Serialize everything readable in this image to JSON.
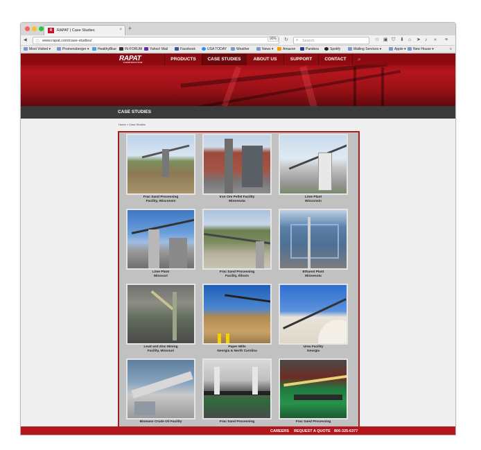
{
  "browser": {
    "tab_title": "RAPAT | Case Studies",
    "favicon_text": "R",
    "tab_close": "×",
    "new_tab": "+",
    "url": "www.rapat.com/case-studies/",
    "zoom": "90%",
    "search_placeholder": "Search",
    "back": "◀",
    "forward": "▶",
    "info": "ⓘ",
    "reload": "↻",
    "search_glyph": "⌕",
    "toolbar_icons": [
      "☆",
      "▣",
      "⛉",
      "⬇",
      "⌂",
      "➤",
      "♪",
      "»",
      "≡"
    ],
    "bookmarks": [
      "Most Visited ▾",
      "Promensberger ▾",
      "HealthyBlue",
      "IN-FORUM",
      "Yahoo! Mail",
      "Facebook",
      "USA TODAY",
      "Weather",
      "News ▾",
      "Amazon",
      "Pandora",
      "Spotify",
      "Mailing Services ▾",
      "Apple ▾",
      "New House ▾"
    ],
    "bookmarks_overflow": "»"
  },
  "site": {
    "logo": "RAPAT",
    "logo_sub": "CORPORATION",
    "nav": [
      "PRODUCTS",
      "CASE STUDIES",
      "ABOUT US",
      "SUPPORT",
      "CONTACT"
    ],
    "nav_search": "⌕",
    "page_title": "CASE STUDIES",
    "breadcrumb": "Home > Case Studies"
  },
  "cards": [
    {
      "line1": "Frac Sand Processing",
      "line2": "Facility, Wisconsin"
    },
    {
      "line1": "Iron Ore Pellet Facility",
      "line2": "Minnesota"
    },
    {
      "line1": "Lime Plant",
      "line2": "Wisconsin"
    },
    {
      "line1": "Lime Plant",
      "line2": "Missouri"
    },
    {
      "line1": "Frac Sand Processing",
      "line2": "Facility, Illinois"
    },
    {
      "line1": "Ethanol Plant",
      "line2": "Minnesota"
    },
    {
      "line1": "Lead and Zinc Mining",
      "line2": "Facility, Missouri"
    },
    {
      "line1": "Paper Mills",
      "line2": "Georgia & North Carolina"
    },
    {
      "line1": "Urea Facility",
      "line2": "Georgia"
    },
    {
      "line1": "Biomass Crude Oil Facility",
      "line2": ""
    },
    {
      "line1": "Frac Sand Processing",
      "line2": ""
    },
    {
      "line1": "Frac Sand Processing",
      "line2": ""
    }
  ],
  "footer": {
    "links": [
      "CAREERS",
      "REQUEST A QUOTE",
      "800-325-6377"
    ]
  }
}
